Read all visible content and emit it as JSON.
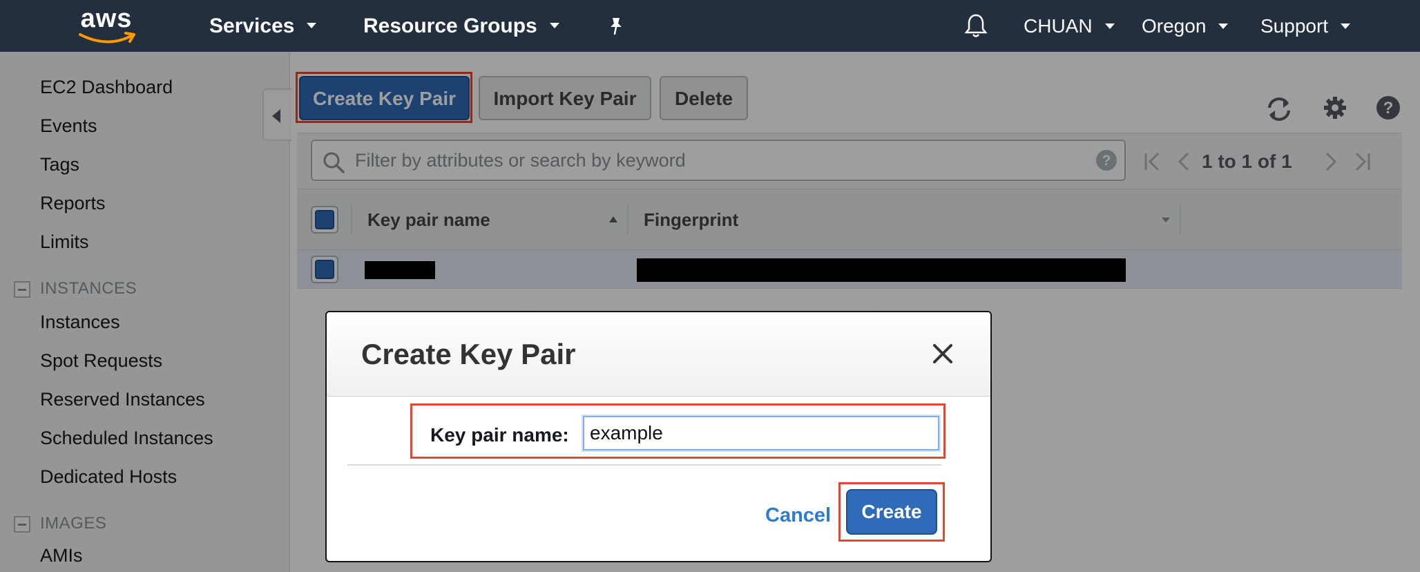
{
  "topnav": {
    "logo_text": "aws",
    "services": "Services",
    "resource_groups": "Resource Groups",
    "account": "CHUAN",
    "region": "Oregon",
    "support": "Support",
    "bg_color": "#232f3e"
  },
  "sidebar": {
    "items": [
      "EC2 Dashboard",
      "Events",
      "Tags",
      "Reports",
      "Limits"
    ],
    "sections": [
      {
        "title": "INSTANCES",
        "items": [
          "Instances",
          "Spot Requests",
          "Reserved Instances",
          "Scheduled Instances",
          "Dedicated Hosts"
        ]
      },
      {
        "title": "IMAGES",
        "items": [
          "AMIs"
        ]
      }
    ]
  },
  "toolbar": {
    "create_label": "Create Key Pair",
    "import_label": "Import Key Pair",
    "delete_label": "Delete"
  },
  "filter": {
    "placeholder": "Filter by attributes or search by keyword",
    "pagination": "1 to 1 of 1"
  },
  "table": {
    "columns": [
      "Key pair name",
      "Fingerprint"
    ],
    "rows": [
      {
        "key_pair_name": "[redacted]",
        "fingerprint": "[redacted]"
      }
    ]
  },
  "modal": {
    "title": "Create Key Pair",
    "field_label": "Key pair name:",
    "field_value": "example",
    "cancel_label": "Cancel",
    "create_label": "Create"
  },
  "colors": {
    "primary": "#2f6bb8",
    "highlight": "#e8452c",
    "link": "#2f7bd0"
  }
}
